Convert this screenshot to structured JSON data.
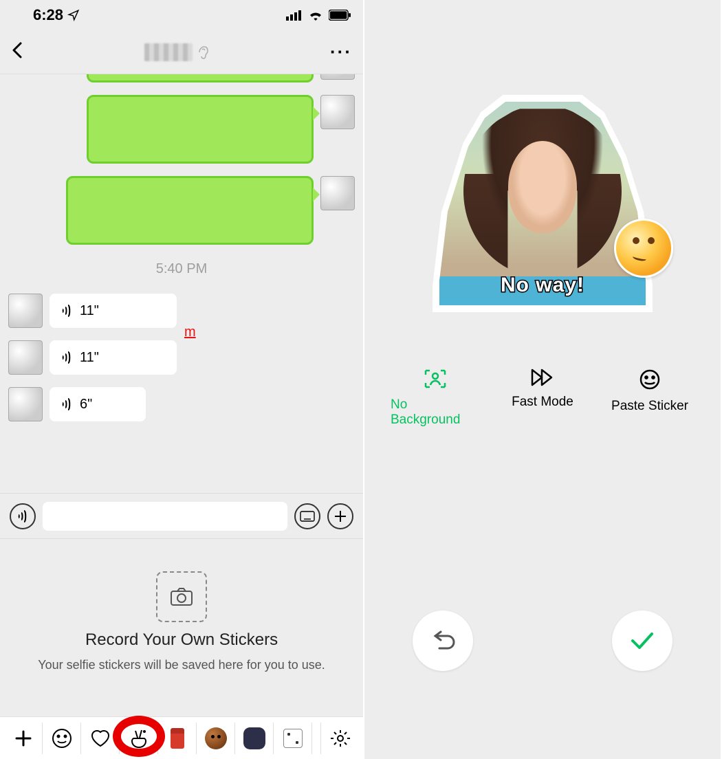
{
  "status_bar": {
    "time": "6:28"
  },
  "chat": {
    "timestamp": "5:40 PM",
    "voices": [
      {
        "duration": "11\""
      },
      {
        "duration": "11\""
      },
      {
        "duration": "6\""
      }
    ],
    "annotate": "m"
  },
  "sticker_panel": {
    "title": "Record Your Own Stickers",
    "subtitle": "Your selfie stickers will be saved here for you to use."
  },
  "editor": {
    "caption": "No way!",
    "options": {
      "no_background": "No Background",
      "fast_mode": "Fast Mode",
      "paste_sticker": "Paste Sticker"
    }
  },
  "icons": {
    "back": "back-icon",
    "more": "more-icon"
  }
}
